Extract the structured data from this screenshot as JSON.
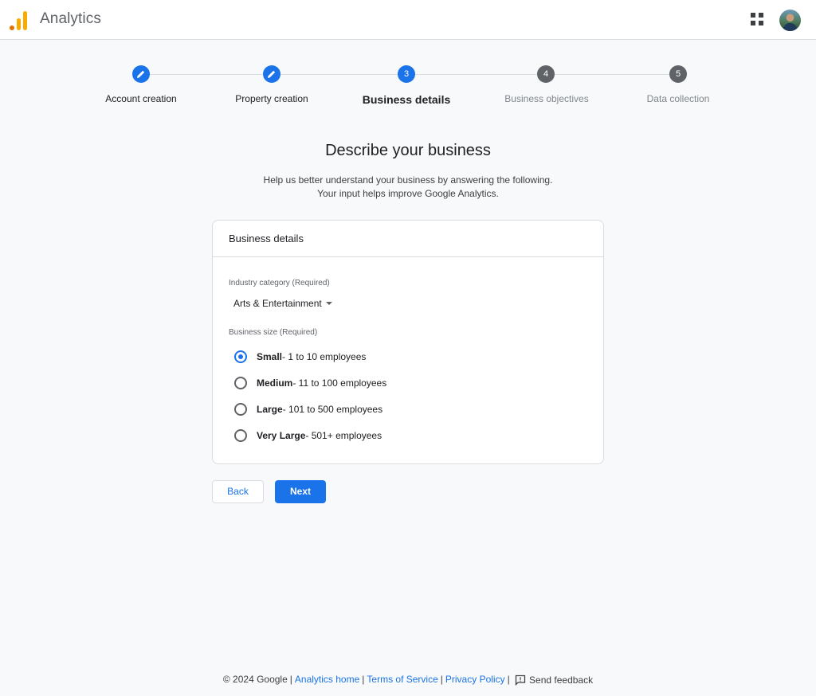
{
  "app": {
    "title": "Analytics"
  },
  "header": {
    "apps_icon": "apps-grid-icon",
    "avatar_icon": "user-avatar"
  },
  "stepper": {
    "steps": [
      {
        "label": "Account creation",
        "state": "done",
        "marker": "pencil-icon"
      },
      {
        "label": "Property creation",
        "state": "done",
        "marker": "pencil-icon"
      },
      {
        "label": "Business details",
        "state": "active",
        "number": "3"
      },
      {
        "label": "Business objectives",
        "state": "todo",
        "number": "4"
      },
      {
        "label": "Data collection",
        "state": "todo",
        "number": "5"
      }
    ]
  },
  "page": {
    "title": "Describe your business",
    "subtitle_line1": "Help us better understand your business by answering the following.",
    "subtitle_line2": "Your input helps improve Google Analytics."
  },
  "card": {
    "title": "Business details",
    "industry_label": "Industry category (Required)",
    "industry_value": "Arts & Entertainment",
    "size_label": "Business size (Required)",
    "size_options": [
      {
        "name": "Small",
        "desc": " - 1 to 10 employees",
        "checked": true
      },
      {
        "name": "Medium",
        "desc": " - 11 to 100 employees",
        "checked": false
      },
      {
        "name": "Large",
        "desc": " - 101 to 500 employees",
        "checked": false
      },
      {
        "name": "Very Large",
        "desc": " - 501+ employees",
        "checked": false
      }
    ]
  },
  "buttons": {
    "back": "Back",
    "next": "Next"
  },
  "footer": {
    "copyright": "© 2024 Google",
    "links": [
      "Analytics home",
      "Terms of Service",
      "Privacy Policy"
    ],
    "feedback": "Send feedback"
  },
  "colors": {
    "accent": "#1a73e8",
    "logo_orange": "#f9ab00",
    "logo_dark_orange": "#e37400"
  }
}
